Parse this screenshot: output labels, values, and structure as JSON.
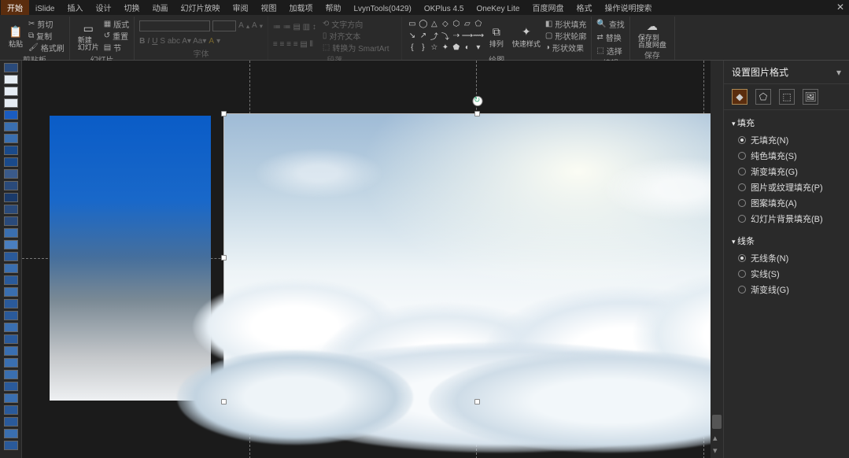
{
  "tabs": [
    "开始",
    "iSlide",
    "插入",
    "设计",
    "切换",
    "动画",
    "幻灯片放映",
    "审阅",
    "视图",
    "加载项",
    "帮助",
    "LvynTools(0429)",
    "OKPlus 4.5",
    "OneKey Lite",
    "百度网盘",
    "格式",
    "操作说明搜索"
  ],
  "activeTab": 0,
  "ribbon": {
    "clipboard": {
      "cut": "剪切",
      "copy": "复制",
      "painter": "格式刷",
      "label": "剪贴板"
    },
    "slides": {
      "new": "新建\n幻灯片",
      "layout": "版式",
      "reset": "重置",
      "section": "节",
      "label": "幻灯片"
    },
    "font": {
      "label": "字体"
    },
    "paragraph": {
      "textdir": "文字方向",
      "align": "对齐文本",
      "smartart": "转换为 SmartArt",
      "label": "段落"
    },
    "drawing": {
      "arrange": "排列",
      "quick": "快速样式",
      "fill": "形状填充",
      "outline": "形状轮廓",
      "effects": "形状效果",
      "label": "绘图"
    },
    "editing": {
      "find": "查找",
      "replace": "替换",
      "select": "选择",
      "label": "编辑"
    },
    "save": {
      "save": "保存到\n百度网盘",
      "label": "保存"
    }
  },
  "side": {
    "title": "设置图片格式",
    "fill": {
      "header": "填充",
      "opts": [
        "无填充(N)",
        "纯色填充(S)",
        "渐变填充(G)",
        "图片或纹理填充(P)",
        "图案填充(A)",
        "幻灯片背景填充(B)"
      ],
      "selected": 0
    },
    "line": {
      "header": "线条",
      "opts": [
        "无线条(N)",
        "实线(S)",
        "渐变线(G)"
      ],
      "selected": 0
    }
  },
  "thumbColors": [
    "#2a4a7a",
    "#e6edf4",
    "#e6edf4",
    "#e6edf4",
    "#1a5cc0",
    "#3a6fb0",
    "#3a6fb0",
    "#1a4a8a",
    "#1a4a8a",
    "#3a5a8a",
    "#2a4a7a",
    "#1a3a6a",
    "#2a4a7a",
    "#2a4a7a",
    "#3a6fb0",
    "#4a7fc0",
    "#2a5a9a",
    "#3a6fb0",
    "#2a5a9a",
    "#3a6fb0",
    "#2a5a9a",
    "#2a5a9a",
    "#3a6fb0",
    "#2a5a9a",
    "#3a6fb0",
    "#3a6fb0",
    "#3a6fb0",
    "#2a5a9a",
    "#3a6fb0",
    "#2a5a9a",
    "#2a5a9a",
    "#3a6fb0",
    "#2a5a9a"
  ]
}
